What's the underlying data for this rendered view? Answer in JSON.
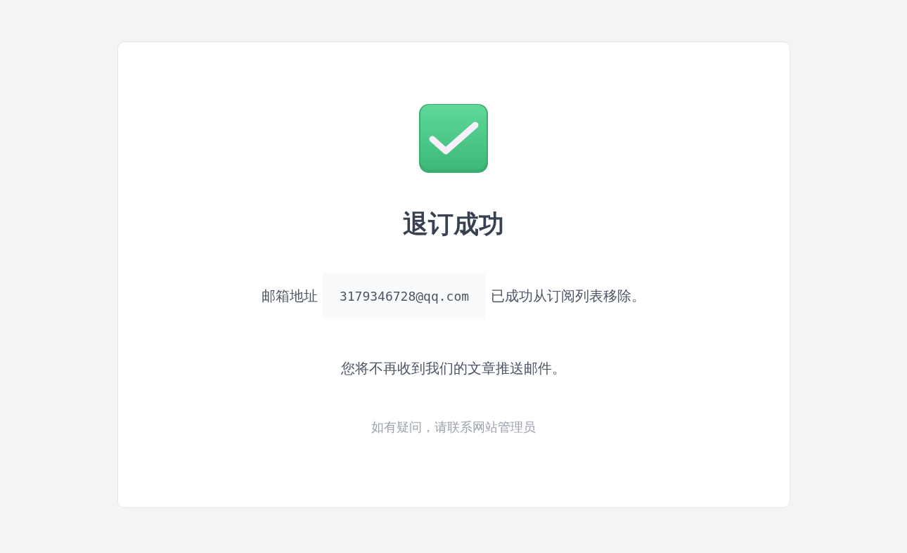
{
  "title": "退订成功",
  "message": {
    "prefix": "邮箱地址",
    "email": "3179346728@qq.com",
    "suffix": "已成功从订阅列表移除。"
  },
  "notice": "您将不再收到我们的文章推送邮件。",
  "footer": "如有疑问，请联系网站管理员"
}
